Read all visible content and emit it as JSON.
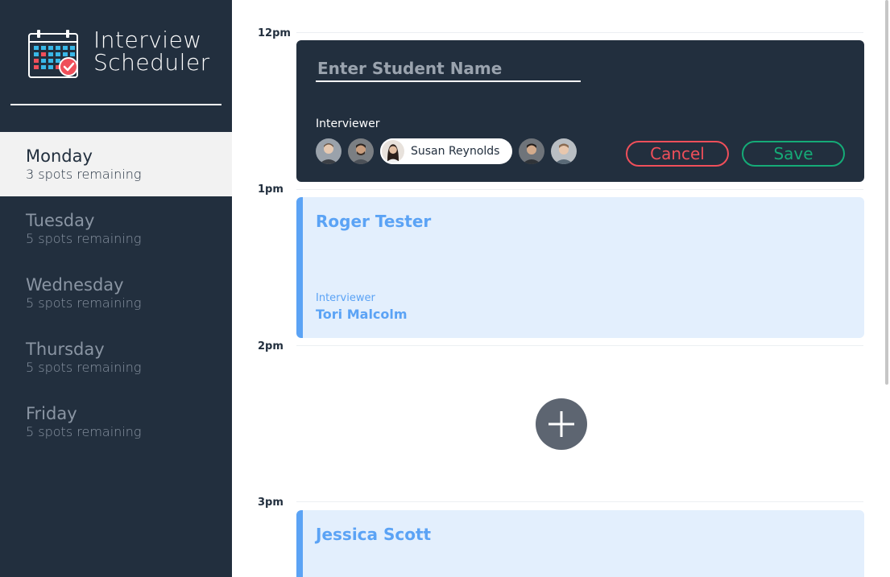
{
  "app": {
    "title_line1": "Interview",
    "title_line2": "Scheduler"
  },
  "days": [
    {
      "name": "Monday",
      "spots": "3 spots remaining",
      "selected": true
    },
    {
      "name": "Tuesday",
      "spots": "5 spots remaining",
      "selected": false
    },
    {
      "name": "Wednesday",
      "spots": "5 spots remaining",
      "selected": false
    },
    {
      "name": "Thursday",
      "spots": "5 spots remaining",
      "selected": false
    },
    {
      "name": "Friday",
      "spots": "5 spots remaining",
      "selected": false
    }
  ],
  "times": [
    "12pm",
    "1pm",
    "2pm",
    "3pm"
  ],
  "form": {
    "student_placeholder": "Enter Student Name",
    "student_value": "",
    "interviewer_heading": "Interviewer",
    "selected_interviewer": "Susan Reynolds",
    "cancel_label": "Cancel",
    "save_label": "Save"
  },
  "appointments": [
    {
      "student": "Roger Tester",
      "interviewer_label": "Interviewer",
      "interviewer": "Tori Malcolm"
    },
    {
      "student": "Jessica Scott"
    }
  ],
  "icons": {
    "logo": "calendar-check-icon",
    "add": "plus-icon"
  },
  "colors": {
    "sidebar": "#222f3e",
    "selected_day_bg": "#f2f2f2",
    "appointment_bg": "#e3effd",
    "appointment_accent": "#5ba3f5",
    "cancel": "#ef4f5a",
    "save": "#15ab77",
    "add_button": "#5d6571"
  }
}
